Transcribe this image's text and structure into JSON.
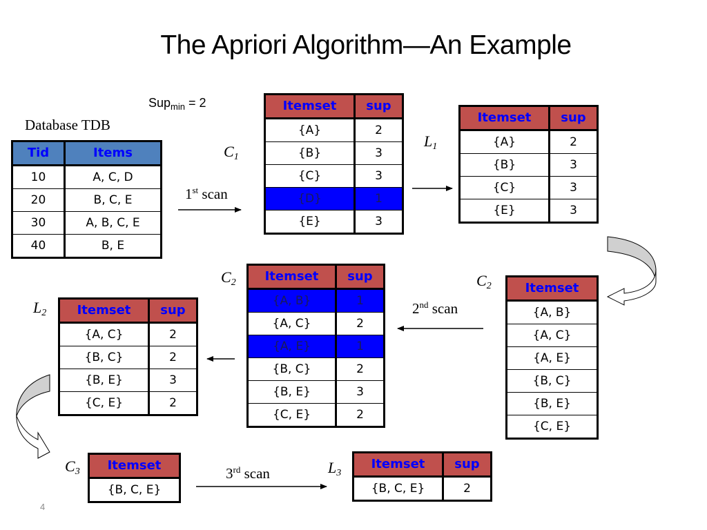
{
  "title": "The Apriori Algorithm—An Example",
  "sup_min": {
    "label": "Sup",
    "sub": "min",
    "value": "= 2"
  },
  "database": {
    "caption": "Database TDB",
    "headers": [
      "Tid",
      "Items"
    ],
    "rows": [
      [
        "10",
        "A, C, D"
      ],
      [
        "20",
        "B, C, E"
      ],
      [
        "30",
        "A, B, C, E"
      ],
      [
        "40",
        "B, E"
      ]
    ]
  },
  "scans": [
    {
      "num": "1",
      "suffix": "st",
      "word": "scan"
    },
    {
      "num": "2",
      "suffix": "nd",
      "word": "scan"
    },
    {
      "num": "3",
      "suffix": "rd",
      "word": "scan"
    }
  ],
  "labels": {
    "c1": {
      "letter": "C",
      "sub": "1"
    },
    "l1": {
      "letter": "L",
      "sub": "1"
    },
    "c2_candidates": {
      "letter": "C",
      "sub": "2"
    },
    "c2_counted": {
      "letter": "C",
      "sub": "2"
    },
    "l2": {
      "letter": "L",
      "sub": "2"
    },
    "c3": {
      "letter": "C",
      "sub": "3"
    },
    "l3": {
      "letter": "L",
      "sub": "3"
    }
  },
  "headers": {
    "itemset": "Itemset",
    "sup": "sup"
  },
  "c1": [
    {
      "itemset": "{A}",
      "sup": "2",
      "pruned": false
    },
    {
      "itemset": "{B}",
      "sup": "3",
      "pruned": false
    },
    {
      "itemset": "{C}",
      "sup": "3",
      "pruned": false
    },
    {
      "itemset": "{D}",
      "sup": "1",
      "pruned": true
    },
    {
      "itemset": "{E}",
      "sup": "3",
      "pruned": false
    }
  ],
  "l1": [
    {
      "itemset": "{A}",
      "sup": "2"
    },
    {
      "itemset": "{B}",
      "sup": "3"
    },
    {
      "itemset": "{C}",
      "sup": "3"
    },
    {
      "itemset": "{E}",
      "sup": "3"
    }
  ],
  "c2_candidates": [
    "{A, B}",
    "{A, C}",
    "{A, E}",
    "{B, C}",
    "{B, E}",
    "{C, E}"
  ],
  "c2_counted": [
    {
      "itemset": "{A, B}",
      "sup": "1",
      "pruned": true
    },
    {
      "itemset": "{A, C}",
      "sup": "2",
      "pruned": false
    },
    {
      "itemset": "{A, E}",
      "sup": "1",
      "pruned": true
    },
    {
      "itemset": "{B, C}",
      "sup": "2",
      "pruned": false
    },
    {
      "itemset": "{B, E}",
      "sup": "3",
      "pruned": false
    },
    {
      "itemset": "{C, E}",
      "sup": "2",
      "pruned": false
    }
  ],
  "l2": [
    {
      "itemset": "{A, C}",
      "sup": "2"
    },
    {
      "itemset": "{B, C}",
      "sup": "2"
    },
    {
      "itemset": "{B, E}",
      "sup": "3"
    },
    {
      "itemset": "{C, E}",
      "sup": "2"
    }
  ],
  "c3": [
    "{B, C, E}"
  ],
  "l3": [
    {
      "itemset": "{B, C, E}",
      "sup": "2"
    }
  ],
  "page_number": "4",
  "colors": {
    "header_red": "#c0504d",
    "header_blue": "#4f81bd",
    "header_text": "#0000ff",
    "pruned_row": "#0000ff"
  }
}
